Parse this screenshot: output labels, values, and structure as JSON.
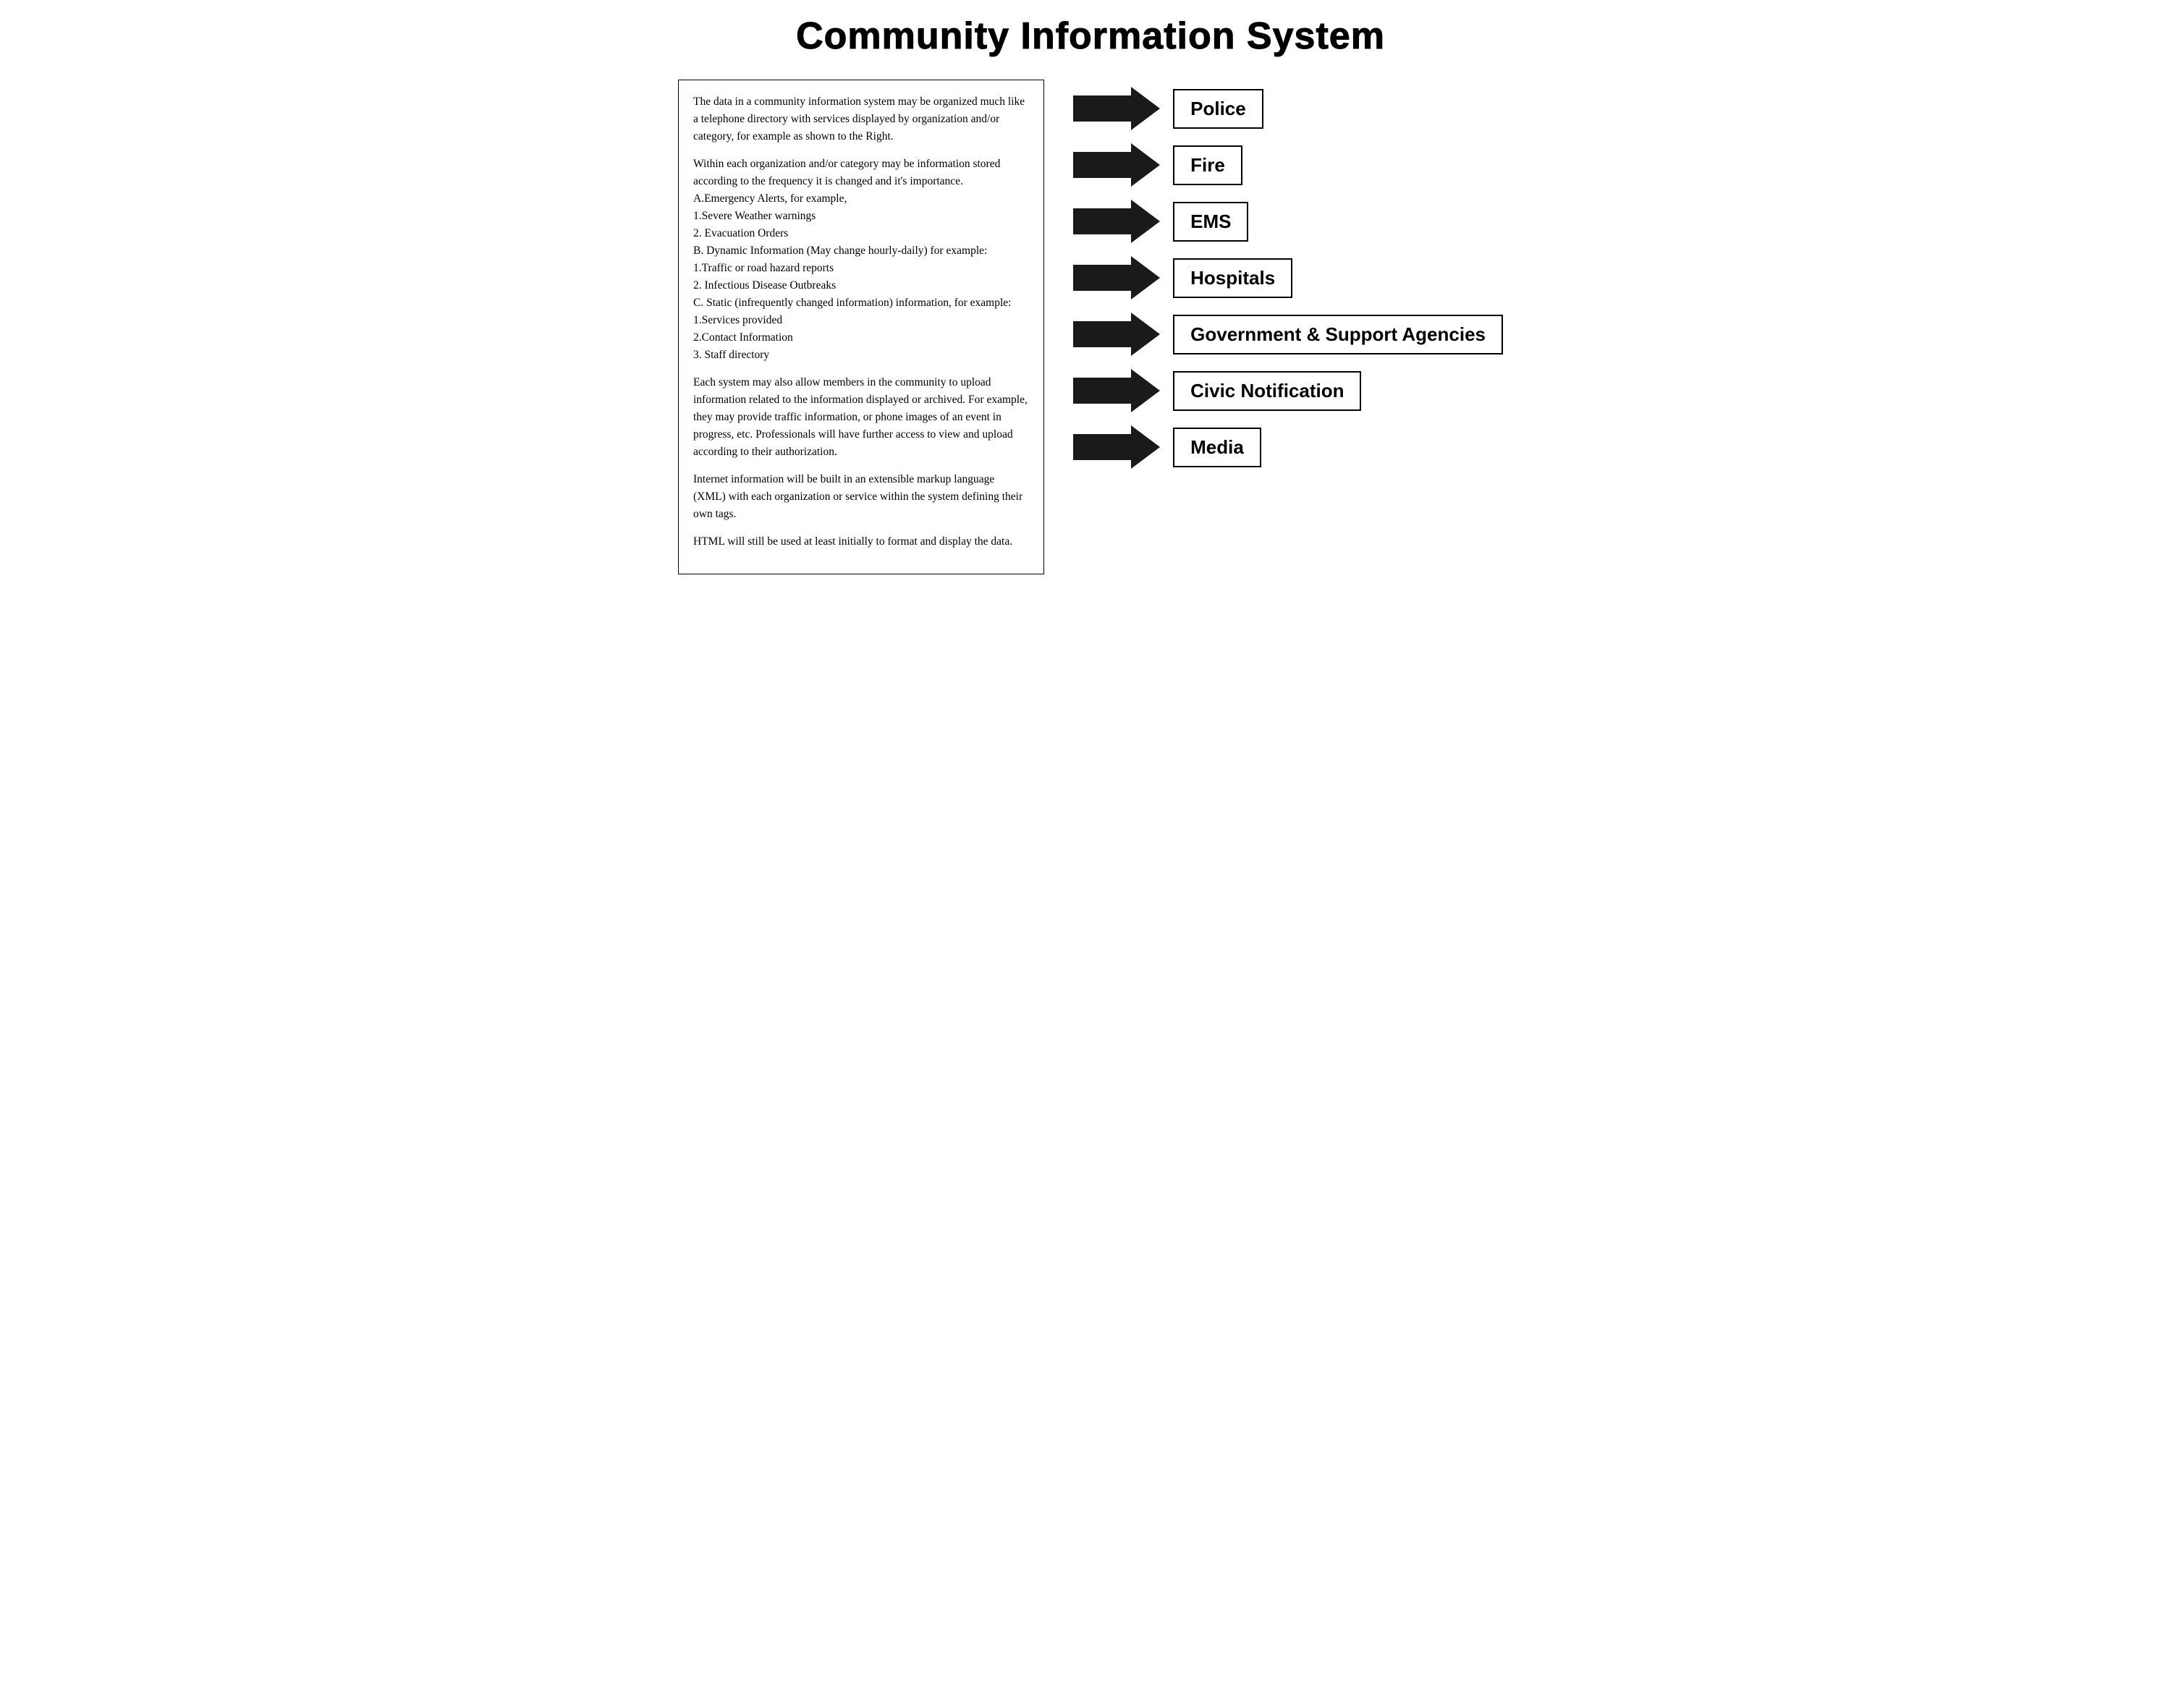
{
  "page": {
    "title": "Community Information System"
  },
  "left_panel": {
    "paragraphs": [
      "The data in a community information system may be organized much like a telephone directory with services displayed by organization and/or category, for example as shown to the Right.",
      "Within each organization and/or category may be information stored according to the frequency it is changed and it's importance.\nA.Emergency Alerts, for example,\n1.Severe Weather warnings\n2. Evacuation Orders\nB. Dynamic Information (May change hourly-daily) for example:\n1.Traffic or road hazard reports\n2. Infectious Disease Outbreaks\nC. Static (infrequently changed information) information, for example:\n1.Services provided\n2.Contact Information\n3. Staff directory",
      "Each system may also allow members in the community to upload information related to the information displayed or archived. For example, they may provide traffic information, or phone images of an event in progress, etc. Professionals will have further access to view and upload according to their authorization.",
      "Internet information will be built in an extensible markup language (XML) with each organization or service within the system defining their own tags.",
      "HTML will still be used at least initially to format and display the data."
    ]
  },
  "right_panel": {
    "items": [
      {
        "label": "Police"
      },
      {
        "label": "Fire"
      },
      {
        "label": "EMS"
      },
      {
        "label": "Hospitals"
      },
      {
        "label": "Government & Support Agencies"
      },
      {
        "label": "Civic Notification"
      },
      {
        "label": "Media"
      }
    ]
  }
}
